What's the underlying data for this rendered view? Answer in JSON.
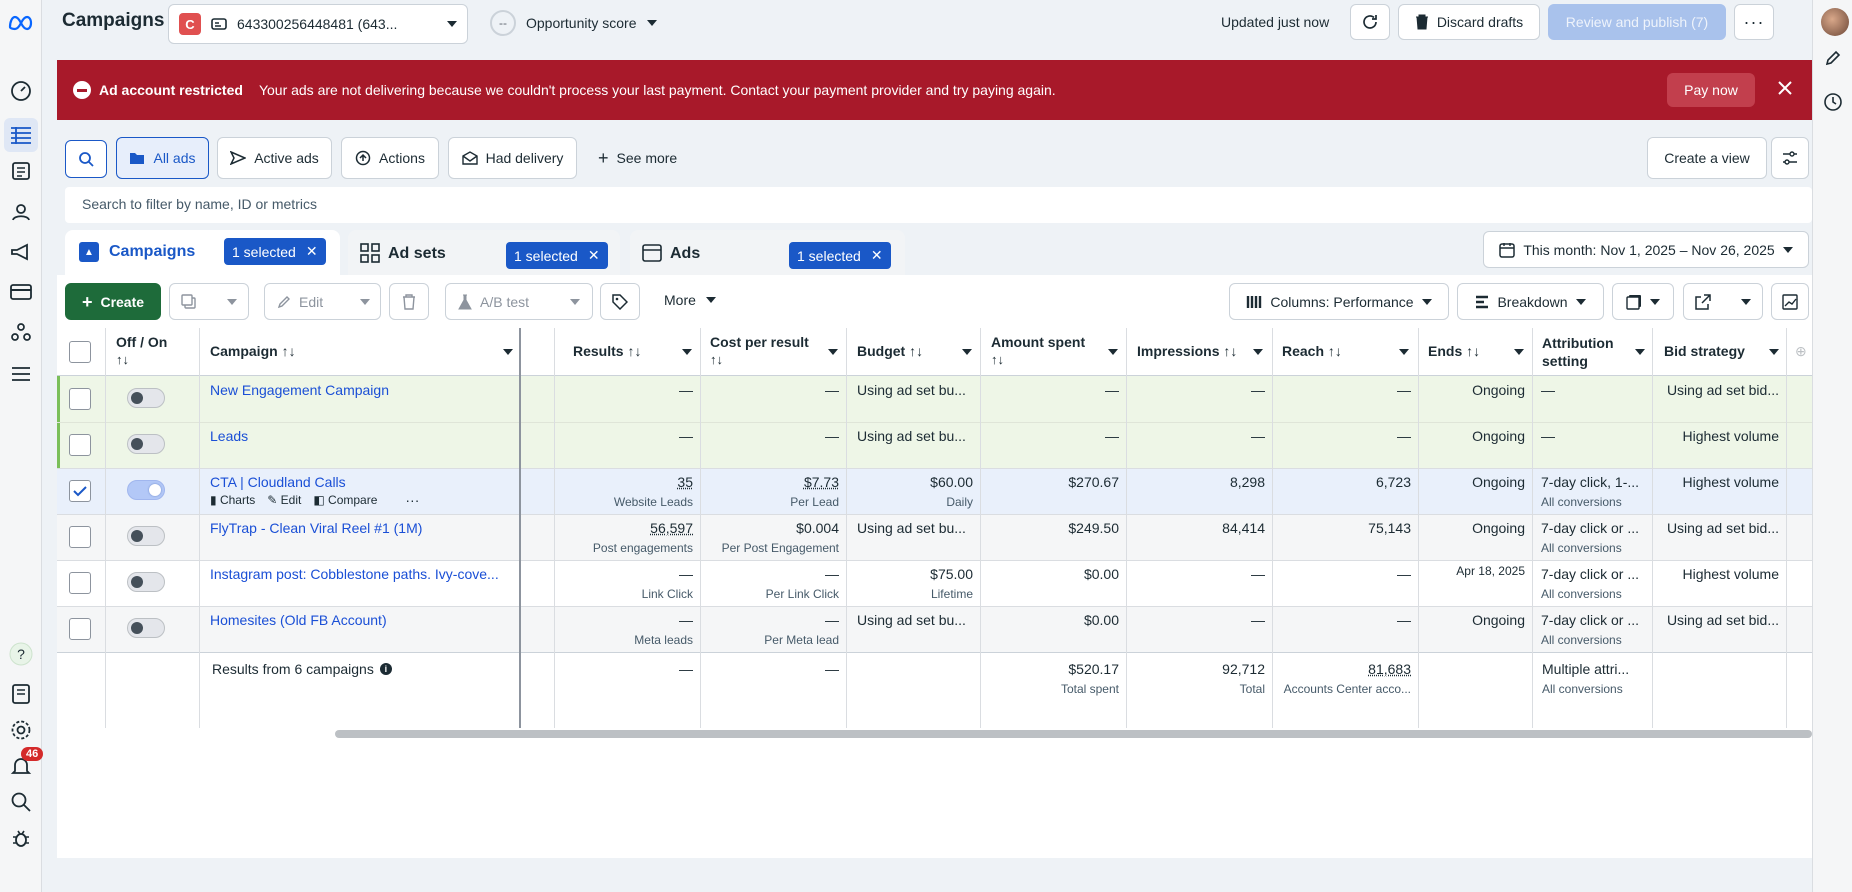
{
  "app": {
    "title": "Campaigns"
  },
  "header": {
    "account_badge": "C",
    "account_label": "643300256448481 (643...",
    "score_badge": "--",
    "score_label": "Opportunity score",
    "updated": "Updated just now",
    "discard": "Discard drafts",
    "review": "Review and publish (7)"
  },
  "banner": {
    "title": "Ad account restricted",
    "message": "Your ads are not delivering because we couldn't process your last payment. Contact your payment provider and try paying again.",
    "pay": "Pay now"
  },
  "filters": {
    "all_ads": "All ads",
    "active_ads": "Active ads",
    "actions": "Actions",
    "had_delivery": "Had delivery",
    "see_more": "See more",
    "create_view": "Create a view",
    "search_placeholder": "Search to filter by name, ID or metrics"
  },
  "tabs": {
    "campaigns": "Campaigns",
    "adsets": "Ad sets",
    "ads": "Ads",
    "selected": "1 selected",
    "date_range": "This month: Nov 1, 2025 – Nov 26, 2025"
  },
  "toolbar": {
    "create": "Create",
    "edit": "Edit",
    "ab_test": "A/B test",
    "more": "More",
    "columns": "Columns: Performance",
    "breakdown": "Breakdown"
  },
  "columns": {
    "offon": "Off / On",
    "campaign": "Campaign",
    "results": "Results",
    "cpr": "Cost per result",
    "budget": "Budget",
    "spent": "Amount spent",
    "impressions": "Impressions",
    "reach": "Reach",
    "ends": "Ends",
    "attribution": "Attribution setting",
    "bid": "Bid strategy"
  },
  "row_actions": {
    "charts": "Charts",
    "edit": "Edit",
    "compare": "Compare"
  },
  "rows": [
    {
      "name": "New Engagement Campaign",
      "results": "—",
      "results_sub": "",
      "cpr": "—",
      "cpr_sub": "",
      "budget": "Using ad set bu...",
      "budget_sub": "",
      "spent": "—",
      "impressions": "—",
      "reach": "—",
      "ends": "Ongoing",
      "attr": "—",
      "attr_sub": "",
      "bid": "Using ad set bid..."
    },
    {
      "name": "Leads",
      "results": "—",
      "results_sub": "",
      "cpr": "—",
      "cpr_sub": "",
      "budget": "Using ad set bu...",
      "budget_sub": "",
      "spent": "—",
      "impressions": "—",
      "reach": "—",
      "ends": "Ongoing",
      "attr": "—",
      "attr_sub": "",
      "bid": "Highest volume"
    },
    {
      "name": "CTA | Cloudland Calls",
      "results": "35",
      "results_sub": "Website Leads",
      "cpr": "$7.73",
      "cpr_sub": "Per Lead",
      "budget": "$60.00",
      "budget_sub": "Daily",
      "spent": "$270.67",
      "impressions": "8,298",
      "reach": "6,723",
      "ends": "Ongoing",
      "attr": "7-day click, 1-...",
      "attr_sub": "All conversions",
      "bid": "Highest volume"
    },
    {
      "name": "FlyTrap - Clean Viral Reel #1 (1M)",
      "results": "56,597",
      "results_sub": "Post engagements",
      "cpr": "$0.004",
      "cpr_sub": "Per Post Engagement",
      "budget": "Using ad set bu...",
      "budget_sub": "",
      "spent": "$249.50",
      "impressions": "84,414",
      "reach": "75,143",
      "ends": "Ongoing",
      "attr": "7-day click or ...",
      "attr_sub": "All conversions",
      "bid": "Using ad set bid..."
    },
    {
      "name": "Instagram post: Cobblestone paths. Ivy-cove...",
      "results": "—",
      "results_sub": "Link Click",
      "cpr": "—",
      "cpr_sub": "Per Link Click",
      "budget": "$75.00",
      "budget_sub": "Lifetime",
      "spent": "$0.00",
      "impressions": "—",
      "reach": "—",
      "ends": "Apr 18, 2025",
      "attr": "7-day click or ...",
      "attr_sub": "All conversions",
      "bid": "Highest volume"
    },
    {
      "name": "Homesites (Old FB Account)",
      "results": "—",
      "results_sub": "Meta leads",
      "cpr": "—",
      "cpr_sub": "Per Meta lead",
      "budget": "Using ad set bu...",
      "budget_sub": "",
      "spent": "$0.00",
      "impressions": "—",
      "reach": "—",
      "ends": "Ongoing",
      "attr": "7-day click or ...",
      "attr_sub": "All conversions",
      "bid": "Using ad set bid..."
    }
  ],
  "totals": {
    "label": "Results from 6 campaigns",
    "results": "—",
    "cpr": "—",
    "spent": "$520.17",
    "spent_sub": "Total spent",
    "impressions": "92,712",
    "impressions_sub": "Total",
    "reach": "81,683",
    "reach_sub": "Accounts Center acco...",
    "attr": "Multiple attri...",
    "attr_sub": "All conversions"
  },
  "notifications": {
    "count": "46"
  },
  "colors": {
    "brand": "#1a58c7",
    "banner": "#a8192a",
    "create": "#1e6b3a"
  }
}
